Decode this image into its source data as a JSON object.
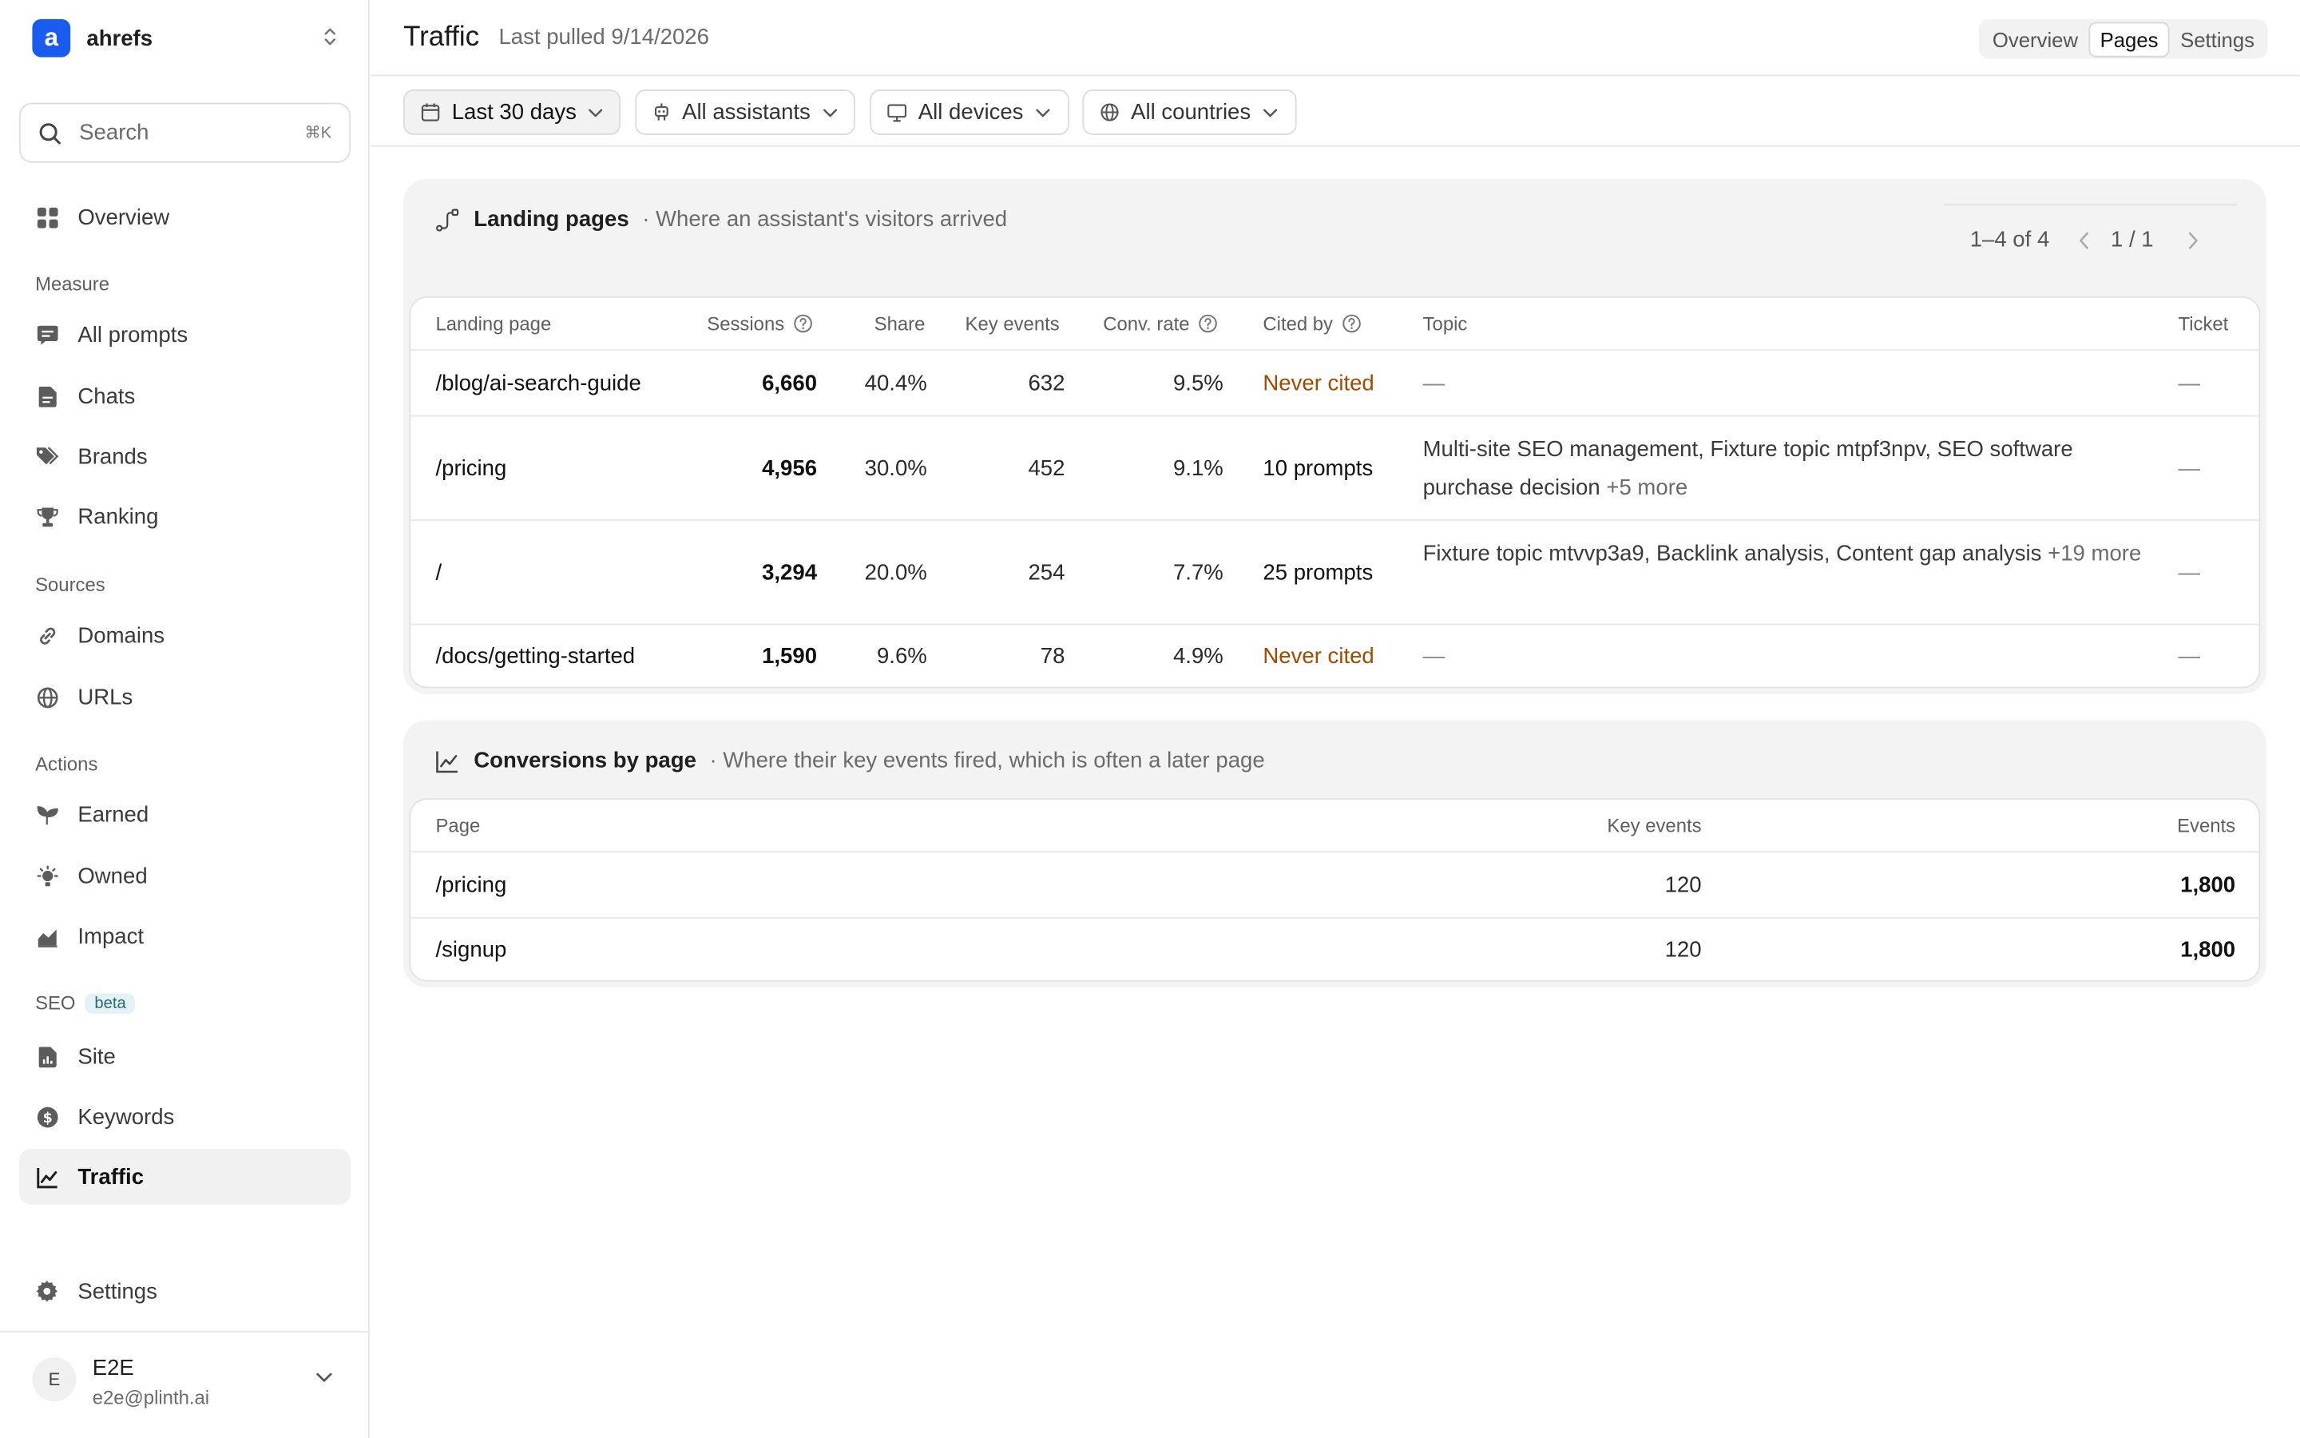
{
  "app": {
    "brand_letter": "a",
    "brand_name": "ahrefs",
    "accent": "#1a5cf0"
  },
  "search": {
    "label": "Search",
    "shortcut": "⌘K"
  },
  "nav": {
    "overview": "Overview",
    "sections": {
      "measure": "Measure",
      "sources": "Sources",
      "actions": "Actions",
      "seo": "SEO",
      "seo_badge": "beta"
    },
    "all_prompts": "All prompts",
    "chats": "Chats",
    "brands": "Brands",
    "ranking": "Ranking",
    "domains": "Domains",
    "urls": "URLs",
    "earned": "Earned",
    "owned": "Owned",
    "impact": "Impact",
    "site": "Site",
    "keywords": "Keywords",
    "traffic": "Traffic",
    "settings": "Settings"
  },
  "user": {
    "initial": "E",
    "name": "E2E",
    "email": "e2e@plinth.ai"
  },
  "header": {
    "title": "Traffic",
    "subtitle": "Last pulled 9/14/2026",
    "tabs": [
      "Overview",
      "Pages",
      "Settings"
    ],
    "active_tab": "Pages"
  },
  "filters": {
    "period": "Last 30 days",
    "assistants": "All assistants",
    "devices": "All devices",
    "countries": "All countries"
  },
  "landing": {
    "title": "Landing pages",
    "subtitle": "· Where an assistant's visitors arrived",
    "pager": {
      "range": "1–4 of 4",
      "page": "1 / 1"
    },
    "columns": {
      "page": "Landing page",
      "sessions": "Sessions",
      "share": "Share",
      "key_events": "Key events",
      "conv_rate": "Conv. rate",
      "cited_by": "Cited by",
      "topic": "Topic",
      "ticket": "Ticket"
    },
    "rows": [
      {
        "page": "/blog/ai-search-guide",
        "sessions": "6,660",
        "share": "40.4%",
        "key_events": "632",
        "conv_rate": "9.5%",
        "cited_by": "Never cited",
        "topic": "—",
        "topic_more": "",
        "ticket": "—"
      },
      {
        "page": "/pricing",
        "sessions": "4,956",
        "share": "30.0%",
        "key_events": "452",
        "conv_rate": "9.1%",
        "cited_by": "10 prompts",
        "topic": "Multi-site SEO management, Fixture topic mtpf3npv, SEO software purchase decision",
        "topic_more": "+5 more",
        "ticket": "—"
      },
      {
        "page": "/",
        "sessions": "3,294",
        "share": "20.0%",
        "key_events": "254",
        "conv_rate": "7.7%",
        "cited_by": "25 prompts",
        "topic": "Fixture topic mtvvp3a9, Backlink analysis, Content gap analysis",
        "topic_more": "+19 more",
        "ticket": "—"
      },
      {
        "page": "/docs/getting-started",
        "sessions": "1,590",
        "share": "9.6%",
        "key_events": "78",
        "conv_rate": "4.9%",
        "cited_by": "Never cited",
        "topic": "—",
        "topic_more": "",
        "ticket": "—"
      }
    ]
  },
  "conversions": {
    "title": "Conversions by page",
    "subtitle": "· Where their key events fired, which is often a later page",
    "columns": {
      "page": "Page",
      "key_events": "Key events",
      "events": "Events"
    },
    "rows": [
      {
        "page": "/pricing",
        "key_events": "120",
        "events": "1,800"
      },
      {
        "page": "/signup",
        "key_events": "120",
        "events": "1,800"
      }
    ]
  }
}
